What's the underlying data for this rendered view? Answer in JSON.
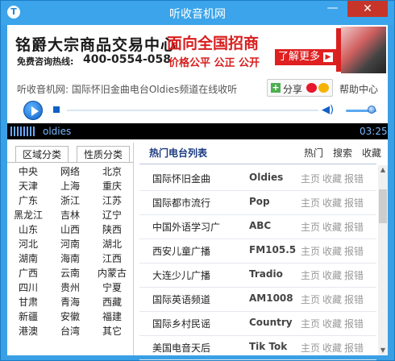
{
  "window": {
    "title": "听收音机网",
    "app_icon": "T",
    "minimize": "—",
    "close": "✕"
  },
  "banner": {
    "title": "铭爵大宗商品交易中心",
    "hotline_label": "免费咨询热线:",
    "hotline_number": "400-0554-058",
    "headline": "面向全国招商",
    "slogan": "价格公平 公正 公开",
    "more_button": "了解更多",
    "more_arrow": "▶"
  },
  "infobar": {
    "breadcrumb": "听收音机网: 国际怀旧金曲电台Oldies频道在线收听",
    "share_label": "分享",
    "share_plus": "+",
    "help_label": "帮助中心"
  },
  "player": {
    "now_playing": "oldies",
    "time": "03:25",
    "volume_glyph": "◀)",
    "volume_level": 0.8
  },
  "left_tabs": {
    "area": "区域分类",
    "nature": "性质分类"
  },
  "regions": [
    [
      "中央",
      "网络",
      "北京"
    ],
    [
      "天津",
      "上海",
      "重庆"
    ],
    [
      "广东",
      "浙江",
      "江苏"
    ],
    [
      "黑龙江",
      "吉林",
      "辽宁"
    ],
    [
      "山东",
      "山西",
      "陕西"
    ],
    [
      "河北",
      "河南",
      "湖北"
    ],
    [
      "湖南",
      "海南",
      "江西"
    ],
    [
      "广西",
      "云南",
      "内蒙古"
    ],
    [
      "四川",
      "贵州",
      "宁夏"
    ],
    [
      "甘肃",
      "青海",
      "西藏"
    ],
    [
      "新疆",
      "安徽",
      "福建"
    ],
    [
      "港澳",
      "台湾",
      "其它"
    ]
  ],
  "hot": {
    "title": "热门电台列表",
    "links": [
      "热门",
      "搜索",
      "收藏"
    ],
    "actions": [
      "主页",
      "收藏",
      "报错"
    ],
    "stations": [
      {
        "name": "国际怀旧金曲",
        "code": "Oldies"
      },
      {
        "name": "国际都市流行",
        "code": "Pop"
      },
      {
        "name": "中国外语学习广",
        "code": "ABC"
      },
      {
        "name": "西安儿童广播",
        "code": "FM105.5"
      },
      {
        "name": "大连少儿广播",
        "code": "Tradio"
      },
      {
        "name": "国际英语频道",
        "code": "AM1008"
      },
      {
        "name": "国际乡村民谣",
        "code": "Country"
      },
      {
        "name": "美国电音天后",
        "code": "Tik Tok"
      }
    ]
  },
  "scrollbar": {
    "up": "▲",
    "down": "▼"
  }
}
